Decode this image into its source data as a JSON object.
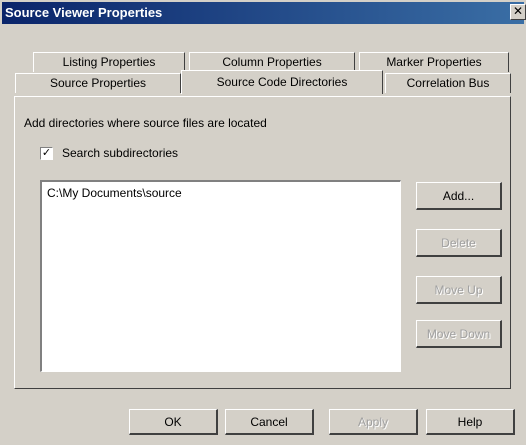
{
  "window": {
    "title": "Source Viewer Properties",
    "close_glyph": "✕"
  },
  "tabs_back_row": [
    {
      "label": "Listing Properties"
    },
    {
      "label": "Column Properties"
    },
    {
      "label": "Marker Properties"
    }
  ],
  "tabs_front_row": [
    {
      "label": "Source Properties"
    },
    {
      "label": "Source Code Directories"
    },
    {
      "label": "Correlation Bus"
    }
  ],
  "panel": {
    "hint": "Add directories where source files are located",
    "search_subdirectories": {
      "label": "Search subdirectories",
      "checked": true,
      "mark": "✓"
    },
    "directories": [
      "C:\\My Documents\\source"
    ]
  },
  "side_buttons": {
    "add": "Add...",
    "delete": "Delete",
    "move_up": "Move Up",
    "move_down": "Move Down"
  },
  "footer_buttons": {
    "ok": "OK",
    "cancel": "Cancel",
    "apply": "Apply",
    "help": "Help"
  }
}
